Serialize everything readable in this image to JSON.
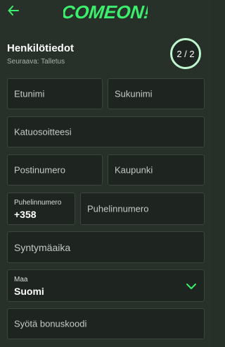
{
  "header": {
    "logo_text": "COMEON!",
    "back_icon": "arrow-left-icon"
  },
  "intro": {
    "title": "Henkilötiedot",
    "subtitle": "Seuraava: Talletus",
    "step": "2 / 2"
  },
  "form": {
    "first_name": {
      "placeholder": "Etunimi"
    },
    "last_name": {
      "placeholder": "Sukunimi"
    },
    "street": {
      "placeholder": "Katuosoitteesi"
    },
    "postal_code": {
      "placeholder": "Postinumero"
    },
    "city": {
      "placeholder": "Kaupunki"
    },
    "phone_prefix": {
      "label": "Puhelinnumero",
      "value": "+358"
    },
    "phone_number": {
      "placeholder": "Puhelinnumero"
    },
    "birth_date": {
      "placeholder": "Syntymäaika"
    },
    "country": {
      "label": "Maa",
      "value": "Suomi",
      "icon": "chevron-down-icon"
    },
    "bonus_code": {
      "placeholder": "Syötä bonuskoodi"
    }
  },
  "colors": {
    "background": "#273129",
    "field_background": "#1e2521",
    "accent": "#3cf06e",
    "field_border": "#3b443d",
    "muted_text": "#a9b0aa"
  }
}
